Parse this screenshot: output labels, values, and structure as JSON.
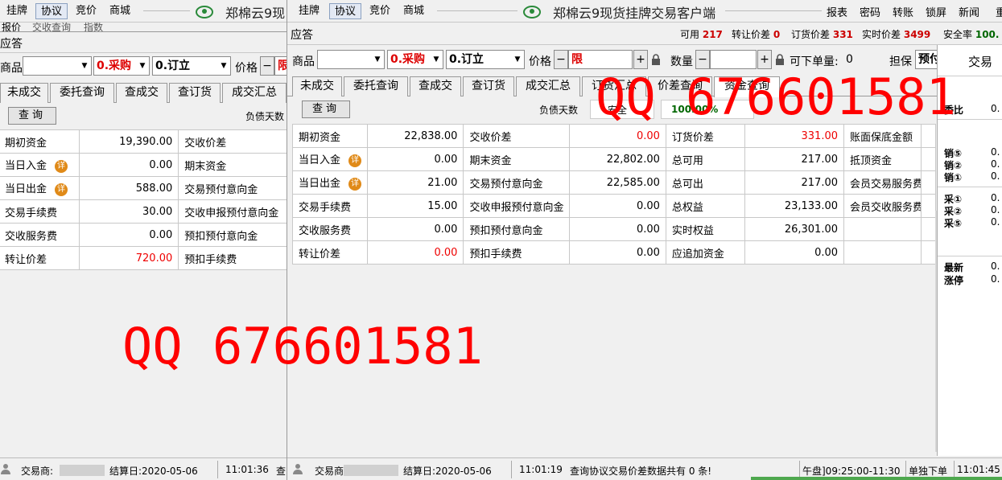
{
  "back": {
    "menus": [
      "挂牌",
      "协议",
      "竞价",
      "商城"
    ],
    "title": "郑棉云9现",
    "subtabs": [
      "报价",
      "交收查询",
      "指数"
    ],
    "ying": "应答",
    "order": {
      "product_label": "商品",
      "side": "0.采购",
      "type": "0.订立",
      "price_label": "价格",
      "price_value": "限"
    },
    "tabs": [
      "未成交",
      "委托查询",
      "查成交",
      "查订货",
      "成交汇总"
    ],
    "query": "查询",
    "debt_days": "负债天数",
    "rows": [
      {
        "l1": "期初资金",
        "v1": "19,390.00",
        "l2": "交收价差"
      },
      {
        "l1": "当日入金",
        "v1": "0.00",
        "l2": "期末资金",
        "xiang": "详"
      },
      {
        "l1": "当日出金",
        "v1": "588.00",
        "l2": "交易预付意向金",
        "xiang": "详"
      },
      {
        "l1": "交易手续费",
        "v1": "30.00",
        "l2": "交收申报预付意向金"
      },
      {
        "l1": "交收服务费",
        "v1": "0.00",
        "l2": "预扣预付意向金"
      },
      {
        "l1": "转让价差",
        "v1": "720.00",
        "l2": "预扣手续费"
      }
    ],
    "status": {
      "trader": "交易商:",
      "settle": "结算日:2020-05-06",
      "time": "11:01:36",
      "tail": "查"
    }
  },
  "front": {
    "menus": [
      "挂牌",
      "协议",
      "竞价",
      "商城"
    ],
    "title": "郑棉云9现货挂牌交易客户端",
    "right_menus": [
      "报表",
      "密码",
      "转账",
      "锁屏",
      "新闻",
      "重"
    ],
    "ying": "应答",
    "stats": [
      {
        "k": "可用",
        "v": "217"
      },
      {
        "k": "转让价差",
        "v": "0"
      },
      {
        "k": "订货价差",
        "v": "331"
      },
      {
        "k": "实时价差",
        "v": "3499"
      },
      {
        "k": "安全率",
        "v": "100."
      }
    ],
    "order": {
      "product_label": "商品",
      "side": "0.采购",
      "type": "0.订立",
      "price_label": "价格",
      "price_value": "限",
      "qty_label": "数量",
      "min_label": "可下单量:",
      "min_value": "0",
      "guar_label": "担保",
      "guar_value": "预付"
    },
    "tabs": [
      "未成交",
      "委托查询",
      "查成交",
      "查订货",
      "成交汇总",
      "订货汇总",
      "价差查询",
      "资金查询"
    ],
    "query": "查询",
    "debt_days": "负债天数",
    "safe_label": "安全",
    "safe_value": "100.00%",
    "rows": [
      {
        "l1": "期初资金",
        "v1": "22,838.00",
        "l2": "交收价差",
        "v2": "0.00",
        "r2": true,
        "l3": "订货价差",
        "v3": "331.00",
        "r3": true,
        "l4": "账面保底金额"
      },
      {
        "l1": "当日入金",
        "xiang": "详",
        "v1": "0.00",
        "l2": "期末资金",
        "v2": "22,802.00",
        "l3": "总可用",
        "v3": "217.00",
        "l4": "抵顶资金"
      },
      {
        "l1": "当日出金",
        "xiang": "详",
        "v1": "21.00",
        "l2": "交易预付意向金",
        "v2": "22,585.00",
        "l3": "总可出",
        "v3": "217.00",
        "l4": "会员交易服务费"
      },
      {
        "l1": "交易手续费",
        "v1": "15.00",
        "l2": "交收申报预付意向金",
        "v2": "0.00",
        "l3": "总权益",
        "v3": "23,133.00",
        "l4": "会员交收服务费"
      },
      {
        "l1": "交收服务费",
        "v1": "0.00",
        "l2": "预扣预付意向金",
        "v2": "0.00",
        "l3": "实时权益",
        "v3": "26,301.00",
        "l4": ""
      },
      {
        "l1": "转让价差",
        "v1": "0.00",
        "r1": true,
        "l2": "预扣手续费",
        "v2": "0.00",
        "l3": "应追加资金",
        "v3": "0.00",
        "l4": ""
      }
    ],
    "status": {
      "trader": "交易商",
      "settle": "结算日:2020-05-06",
      "time": "11:01:19",
      "msg": "查询协议交易价差数据共有 0 条!",
      "session": "午盘]09:25:00-11:30",
      "single": "单独下单",
      "clock": "11:01:45"
    }
  },
  "side_panel": {
    "title": "交易",
    "ratio": "委比",
    "sell": [
      "销⑤",
      "销②",
      "销①"
    ],
    "buy": [
      "采①",
      "采②",
      "采⑤"
    ],
    "latest": "最新",
    "limitup": "涨停",
    "zero": "0."
  },
  "watermarks": [
    "QQ 676601581",
    "QQ 676601581"
  ]
}
